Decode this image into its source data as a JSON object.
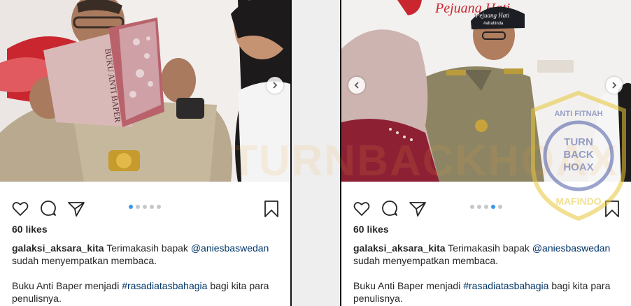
{
  "watermark_text": "TURNBACKHOAX",
  "mafindo_badge": {
    "top_text": "ANTI FITNAH",
    "lines": [
      "TURN",
      "BACK",
      "HOAX"
    ],
    "bottom_text": "MAFINDO"
  },
  "photo_right_text": {
    "sign": "Pejuang Hati",
    "cap": "Pejuang Hati",
    "cap_sub": "#afrahinda"
  },
  "posts": [
    {
      "book": {
        "title": "BUKU ANTI BAPER"
      },
      "likes": "60 likes",
      "caption": {
        "username": "galaksi_aksara_kita",
        "text1": "Terimakasih bapak",
        "mention": "@aniesbaswedan",
        "text2": "sudah menyempatkan membaca.",
        "text3": "Buku Anti Baper menjadi",
        "hashtag": "#rasadiatasbahagia",
        "text4": "bagi kita para penulisnya."
      },
      "carousel": {
        "count": 5,
        "active": 0
      }
    },
    {
      "likes": "60 likes",
      "caption": {
        "username": "galaksi_aksara_kita",
        "text1": "Terimakasih bapak",
        "mention": "@aniesbaswedan",
        "text2": "sudah menyempatkan membaca.",
        "text3": "Buku Anti Baper menjadi",
        "hashtag": "#rasadiatasbahagia",
        "text4": "bagi kita para penulisnya."
      },
      "carousel": {
        "count": 5,
        "active": 3
      }
    }
  ],
  "icons": [
    "heart-icon",
    "comment-icon",
    "share-icon",
    "bookmark-icon",
    "chevron-left-icon",
    "chevron-right-icon"
  ],
  "colors": {
    "link": "#003569",
    "active_dot": "#3897f0",
    "inactive_dot": "#c7c7c7"
  }
}
